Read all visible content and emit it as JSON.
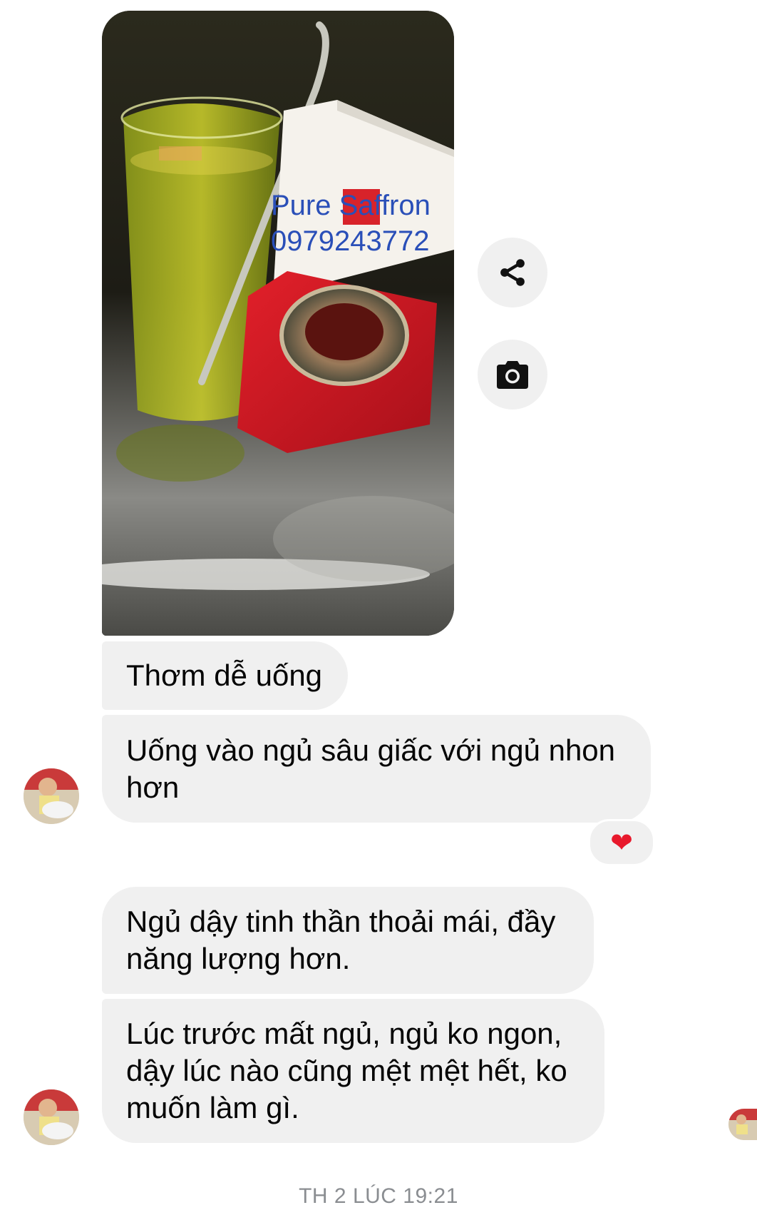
{
  "photo": {
    "watermark_line1": "Pure Saffron",
    "watermark_line2": "0979243772"
  },
  "actions": {
    "share_icon": "share-icon",
    "camera_icon": "camera-icon"
  },
  "messages": [
    {
      "text": "Thơm dễ uống"
    },
    {
      "text": "Uống vào ngủ sâu giấc với ngủ nhon hơn"
    },
    {
      "text": "Ngủ dậy tinh thần thoải mái, đầy năng lượng hơn."
    },
    {
      "text": "Lúc trước mất ngủ, ngủ ko ngon, dậy lúc nào cũng mệt mệt hết, ko muốn làm gì."
    }
  ],
  "reaction": {
    "emoji": "❤"
  },
  "timestamp": "TH 2 LÚC 19:21",
  "colors": {
    "bubble_bg": "#f0f0f0",
    "text": "#050505",
    "timestamp": "#8a8d91",
    "watermark": "#2a4fb8",
    "heart": "#e8192c"
  }
}
